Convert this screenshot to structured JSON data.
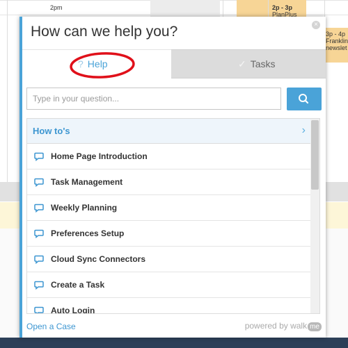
{
  "calendar": {
    "time_label": "2pm",
    "events": [
      {
        "time": "2p - 3p",
        "title": "PlanPlus"
      },
      {
        "time": "3p - 4p",
        "title": "Franklin",
        "subtitle": "newslet"
      }
    ]
  },
  "widget": {
    "title": "How can we help you?",
    "close_glyph": "×",
    "tabs": [
      {
        "label": "Help",
        "icon": "?",
        "active": true
      },
      {
        "label": "Tasks",
        "icon": "✓",
        "active": false
      }
    ],
    "search": {
      "placeholder": "Type in your question...",
      "value": ""
    },
    "section": {
      "title": "How to's",
      "chevron": "›"
    },
    "items": [
      {
        "label": "Home Page Introduction"
      },
      {
        "label": "Task Management"
      },
      {
        "label": "Weekly Planning"
      },
      {
        "label": "Preferences Setup"
      },
      {
        "label": "Cloud Sync Connectors"
      },
      {
        "label": "Create a Task"
      },
      {
        "label": "Auto Login"
      }
    ],
    "footer": {
      "open_case": "Open a Case",
      "powered_by": "powered by walk",
      "brand": "me"
    }
  },
  "colors": {
    "accent": "#4aa3d8",
    "annotation": "#e0101a",
    "event": "#f7d596",
    "bottom_bar": "#2c3f58"
  }
}
